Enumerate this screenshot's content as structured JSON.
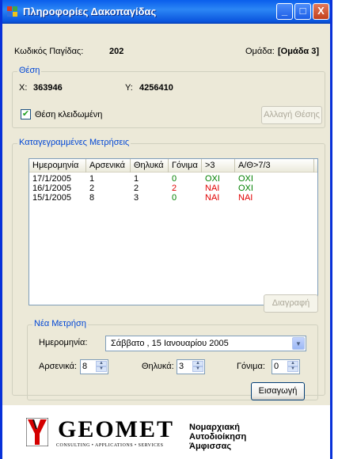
{
  "window": {
    "title": "Πληροφορίες Δακοπαγίδας",
    "controls": {
      "minimize": "_",
      "maximize": "□",
      "close": "X"
    }
  },
  "trap": {
    "code_label": "Κωδικός Παγίδας:",
    "code_value": "202",
    "group_label": "Ομάδα:",
    "group_value": "[Ομάδα 3]"
  },
  "position": {
    "legend": "Θέση",
    "x_label": "X:",
    "x_value": "363946",
    "y_label": "Y:",
    "y_value": "4256410",
    "locked_label": "Θέση κλειδωμένη",
    "locked_checked": true,
    "change_button": "Αλλαγή Θέσης"
  },
  "measurements": {
    "legend": "Καταγεγραμμένες Μετρήσεις",
    "columns": [
      "Ημερομηνία",
      "Αρσενικά",
      "Θηλυκά",
      "Γόνιμα",
      ">3",
      "Α/Θ>7/3"
    ],
    "rows": [
      {
        "date": "17/1/2005",
        "male": "1",
        "female": "1",
        "fertile": "0",
        "gt3": "ΟΧΙ",
        "ratio": "ΟΧΙ"
      },
      {
        "date": "16/1/2005",
        "male": "2",
        "female": "2",
        "fertile": "2",
        "gt3": "ΝΑΙ",
        "ratio": "ΟΧΙ"
      },
      {
        "date": "15/1/2005",
        "male": "8",
        "female": "3",
        "fertile": "0",
        "gt3": "ΝΑΙ",
        "ratio": "ΝΑΙ"
      }
    ],
    "delete_button": "Διαγραφή"
  },
  "new_measurement": {
    "legend": "Νέα Μετρήση",
    "date_label": "Ημερομηνία:",
    "date_value": "Σάββατο  , 15  Ιανουαρίου  2005",
    "male_label": "Αρσενικά:",
    "male_value": "8",
    "female_label": "Θηλυκά:",
    "female_value": "3",
    "fertile_label": "Γόνιμα:",
    "fertile_value": "0",
    "insert_button": "Εισαγωγή"
  },
  "footer": {
    "logo_text": "GEOMET",
    "logo_sub": "CONSULTING • APPLICATIONS • SERVICES",
    "org_line1": "Νομαρχιακή",
    "org_line2": "Αυτοδιοίκηση",
    "org_line3": "Άμφισσας"
  },
  "colors": {
    "titlebar": "#0a5eec",
    "legend_text": "#0046d5",
    "yes_red": "#e00000",
    "no_green": "#008000",
    "logo_red": "#d40000"
  }
}
